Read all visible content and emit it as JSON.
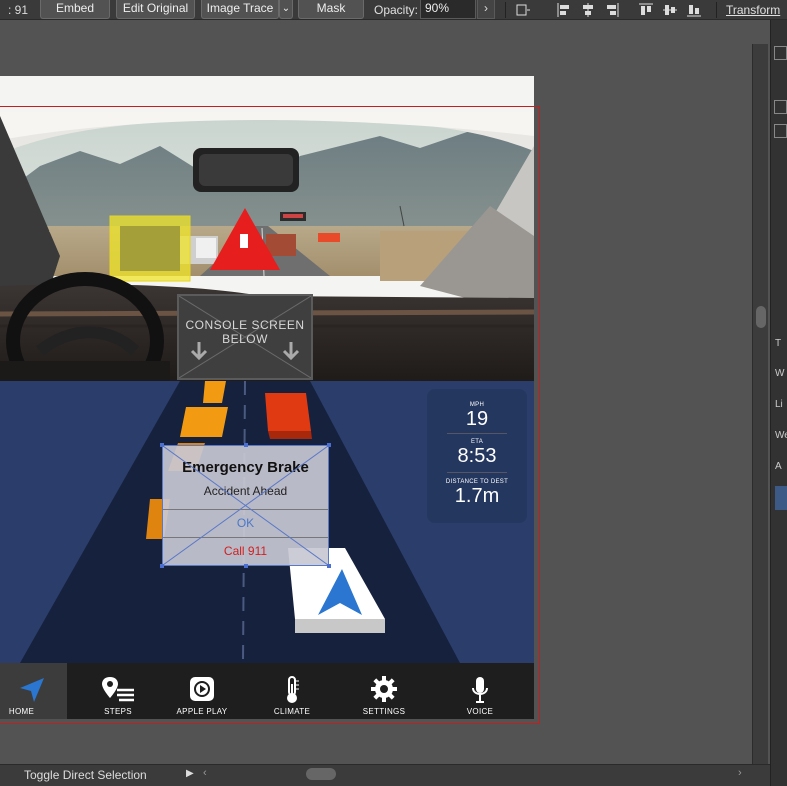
{
  "control_bar": {
    "width_value": ": 91",
    "embed": "Embed",
    "edit_original": "Edit Original",
    "image_trace": "Image Trace",
    "mask": "Mask",
    "opacity_label": "Opacity:",
    "opacity_value": "90%",
    "transform": "Transform"
  },
  "console": {
    "text": "CONSOLE SCREEN\nBELOW"
  },
  "stats": {
    "speed_label": "MPH",
    "speed_value": "19",
    "eta_label": "ETA",
    "eta_value": "8:53",
    "distance_label": "DISTANCE TO DEST",
    "distance_value": "1.7m"
  },
  "alert": {
    "title": "Emergency Brake",
    "message": "Accident Ahead",
    "ok": "OK",
    "call": "Call 911"
  },
  "nav": {
    "items": [
      {
        "label": "HOME",
        "icon": "navigation-arrow-icon",
        "active": true
      },
      {
        "label": "STEPS",
        "icon": "steps-pin-icon"
      },
      {
        "label": "APPLE PLAY",
        "icon": "apple-play-icon"
      },
      {
        "label": "CLIMATE",
        "icon": "thermometer-icon"
      },
      {
        "label": "SETTINGS",
        "icon": "gear-icon"
      },
      {
        "label": "VOICE",
        "icon": "microphone-icon"
      }
    ]
  },
  "status_bar": {
    "tool_hint": "Toggle Direct Selection"
  },
  "right_panel": {
    "letters": [
      "T",
      "W",
      "Li",
      "We",
      "A"
    ]
  },
  "colors": {
    "road": "#2a3d6b",
    "alert_ok": "#4b78c8",
    "alert_call": "#d02020",
    "hazard_red": "#e61e1e",
    "nav_active": "#3c3c3c"
  }
}
